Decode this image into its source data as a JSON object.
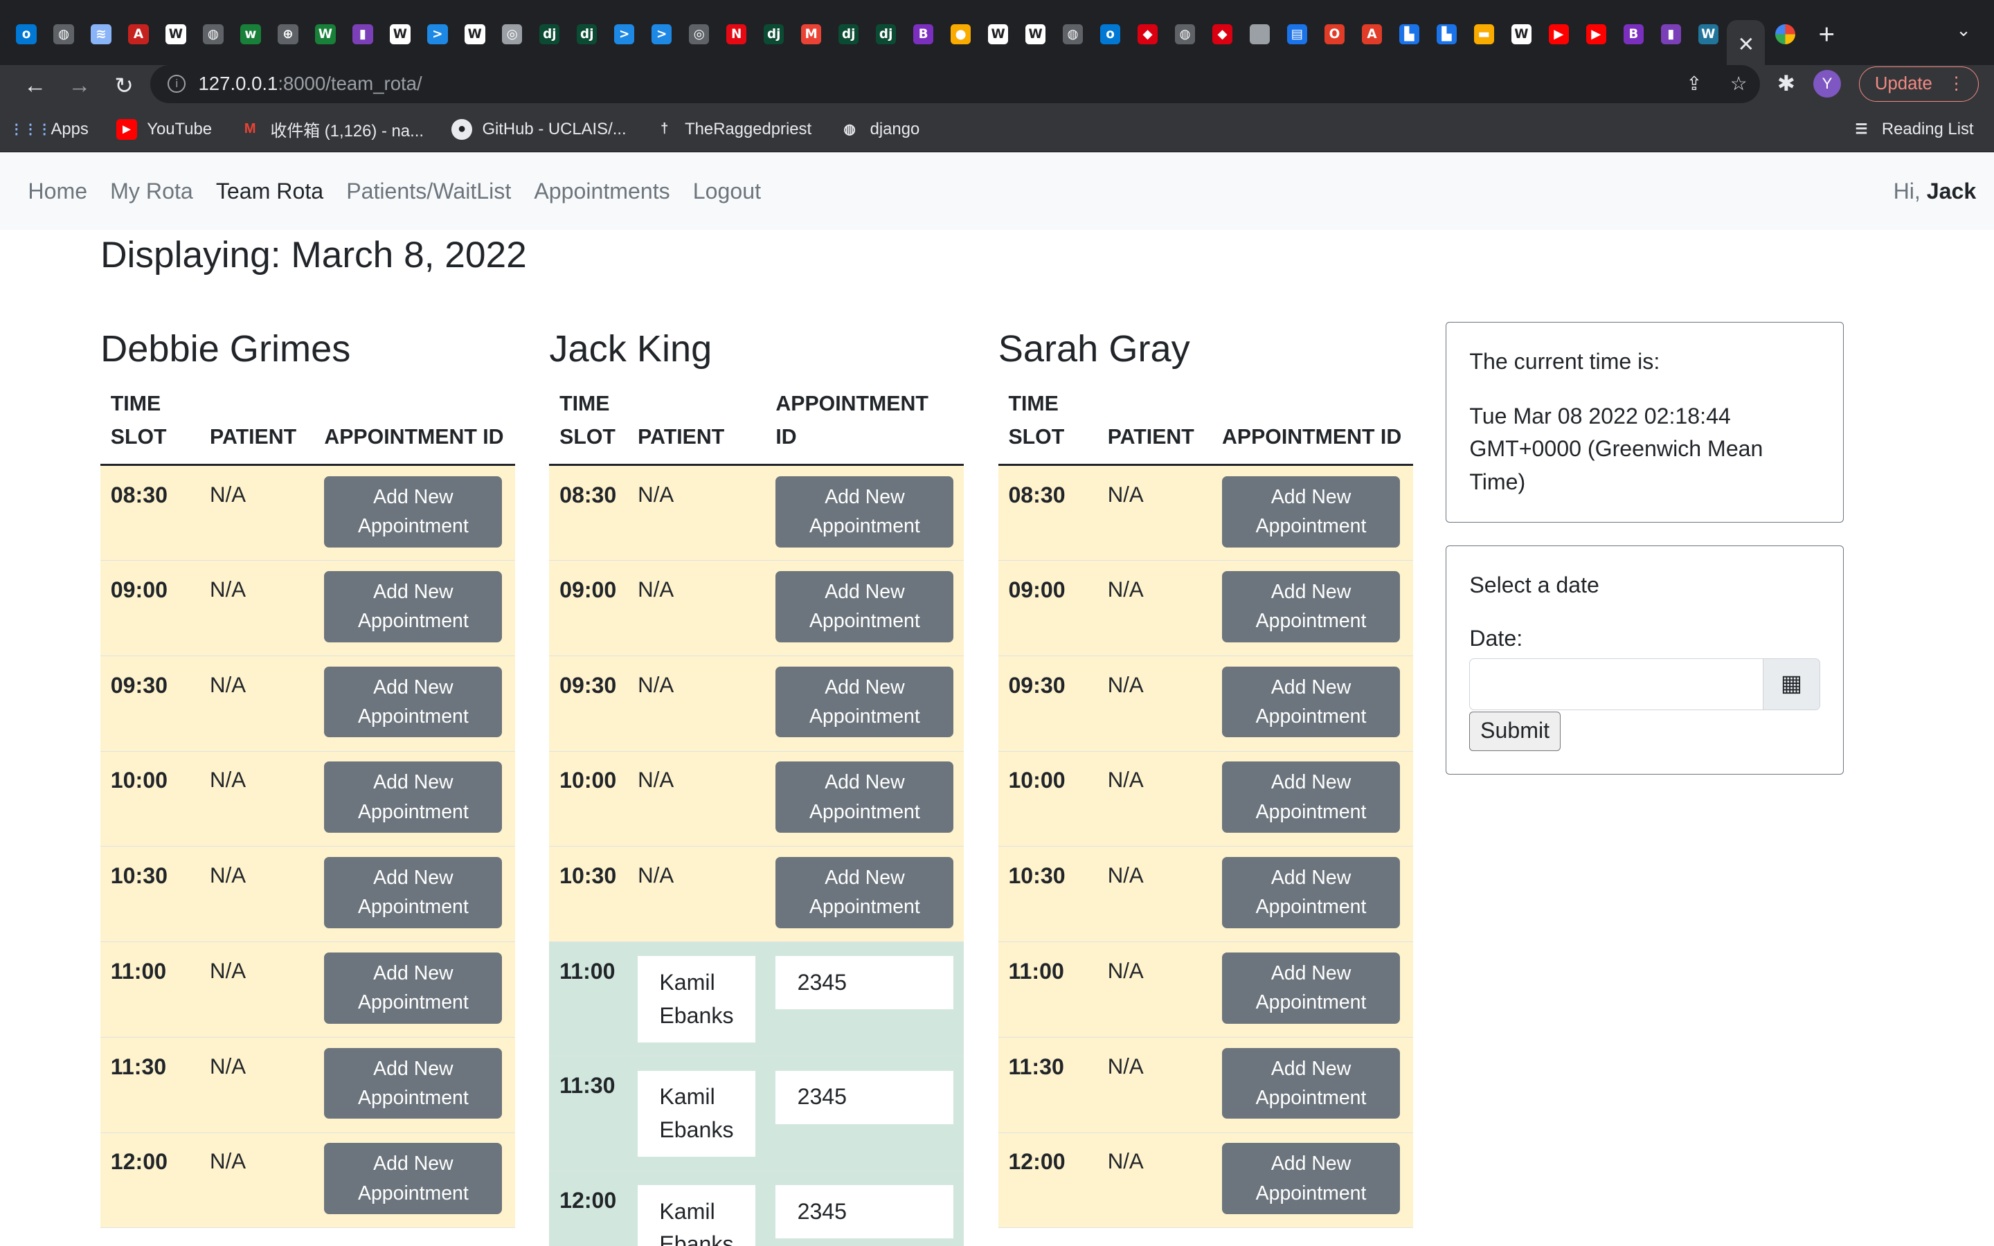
{
  "browser": {
    "url_host": "127.0.0.1",
    "url_rest": ":8000/team_rota/",
    "update_label": "Update",
    "avatar_letter": "Y",
    "bookmarks": [
      "Apps",
      "YouTube",
      "收件箱 (1,126) - na...",
      "GitHub - UCLAIS/...",
      "TheRaggedpriest",
      "django"
    ],
    "reading_list": "Reading List"
  },
  "nav": {
    "links": [
      "Home",
      "My Rota",
      "Team Rota",
      "Patients/WaitList",
      "Appointments",
      "Logout"
    ],
    "greeting": "Hi,",
    "user": "Jack"
  },
  "page": {
    "displaying": "Displaying: March 8, 2022",
    "headers": {
      "time": "TIME SLOT",
      "patient": "PATIENT",
      "appt": "APPOINTMENT ID"
    },
    "add_label": "Add New Appointment",
    "na": "N/A",
    "doctors": [
      {
        "name": "Debbie Grimes",
        "slots": [
          {
            "time": "08:30",
            "patient": null,
            "id": null
          },
          {
            "time": "09:00",
            "patient": null,
            "id": null
          },
          {
            "time": "09:30",
            "patient": null,
            "id": null
          },
          {
            "time": "10:00",
            "patient": null,
            "id": null
          },
          {
            "time": "10:30",
            "patient": null,
            "id": null
          },
          {
            "time": "11:00",
            "patient": null,
            "id": null
          },
          {
            "time": "11:30",
            "patient": null,
            "id": null
          },
          {
            "time": "12:00",
            "patient": null,
            "id": null
          }
        ]
      },
      {
        "name": "Jack King",
        "slots": [
          {
            "time": "08:30",
            "patient": null,
            "id": null
          },
          {
            "time": "09:00",
            "patient": null,
            "id": null
          },
          {
            "time": "09:30",
            "patient": null,
            "id": null
          },
          {
            "time": "10:00",
            "patient": null,
            "id": null
          },
          {
            "time": "10:30",
            "patient": null,
            "id": null
          },
          {
            "time": "11:00",
            "patient": "Kamil Ebanks",
            "id": "2345"
          },
          {
            "time": "11:30",
            "patient": "Kamil Ebanks",
            "id": "2345"
          },
          {
            "time": "12:00",
            "patient": "Kamil Ebanks",
            "id": "2345"
          }
        ]
      },
      {
        "name": "Sarah Gray",
        "slots": [
          {
            "time": "08:30",
            "patient": null,
            "id": null
          },
          {
            "time": "09:00",
            "patient": null,
            "id": null
          },
          {
            "time": "09:30",
            "patient": null,
            "id": null
          },
          {
            "time": "10:00",
            "patient": null,
            "id": null
          },
          {
            "time": "10:30",
            "patient": null,
            "id": null
          },
          {
            "time": "11:00",
            "patient": null,
            "id": null
          },
          {
            "time": "11:30",
            "patient": null,
            "id": null
          },
          {
            "time": "12:00",
            "patient": null,
            "id": null
          }
        ]
      }
    ]
  },
  "sidebar": {
    "current_time_label": "The current time is:",
    "current_time": "Tue Mar 08 2022 02:18:44 GMT+0000 (Greenwich Mean Time)",
    "select_date": "Select a date",
    "date_label": "Date:",
    "date_value": "",
    "submit": "Submit"
  },
  "colors": {
    "free_row": "#fff3cd",
    "booked_row": "#d1e7dd",
    "button": "#6c757d"
  }
}
